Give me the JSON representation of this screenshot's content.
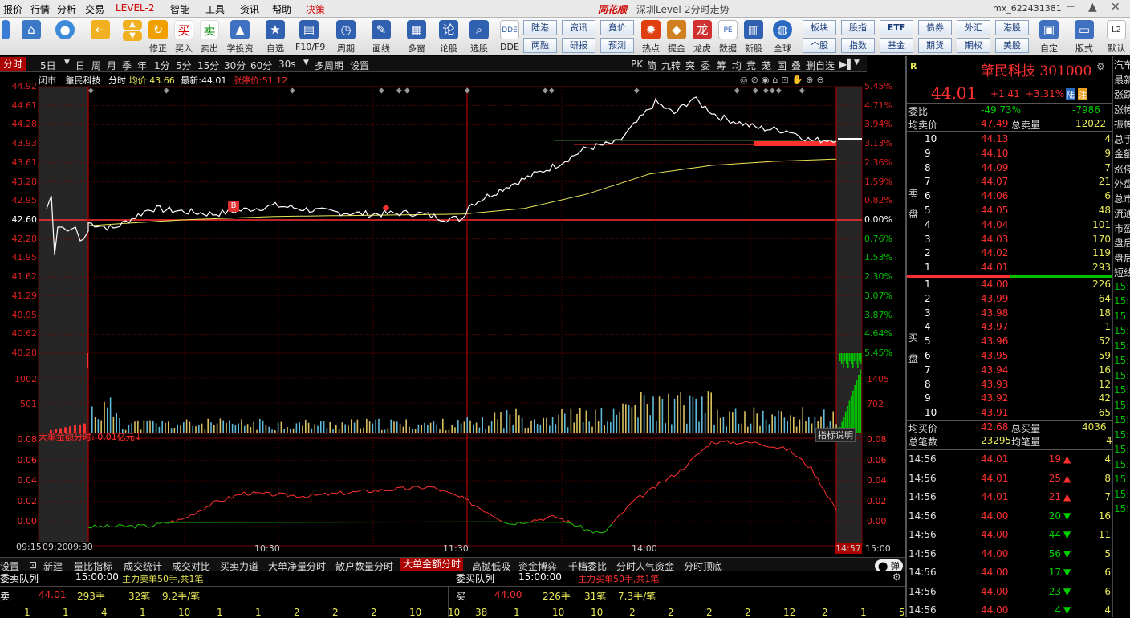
{
  "menubar": {
    "items": [
      "报价",
      "行情",
      "分析",
      "交易",
      "LEVEL-2",
      "智能",
      "工具",
      "资讯",
      "帮助",
      "决策"
    ],
    "title_brand": "同花顺",
    "title": "深圳Level-2分时走势",
    "account": "mx_622431381"
  },
  "toolbar": {
    "buttons": [
      "修正",
      "买入",
      "卖出",
      "学投资",
      "自选",
      "F10/F9",
      "周期",
      "画线",
      "多窗",
      "论股",
      "选股",
      "DDE",
      "热点",
      "提金",
      "龙虎",
      "数据",
      "新股",
      "全球",
      "自定",
      "版式",
      "默认"
    ],
    "small": [
      "陆港",
      "资讯",
      "竟价",
      "两融",
      "研报",
      "预测",
      "板块",
      "股指",
      "ETF",
      "债券",
      "外汇",
      "港股",
      "个股",
      "指数",
      "基金",
      "期货",
      "期权",
      "美股"
    ]
  },
  "period": {
    "items": [
      "分时",
      "5日",
      "日",
      "周",
      "月",
      "季",
      "年",
      "1分",
      "5分",
      "15分",
      "30分",
      "60分",
      "30s",
      "多周期",
      "设置"
    ],
    "right": [
      "PK",
      "简",
      "九转",
      "突",
      "委",
      "筹",
      "均",
      "竞",
      "茏",
      "固",
      "叠",
      "删自选"
    ]
  },
  "chartinfo": {
    "status": "闭市",
    "name": "肇民科技",
    "mode": "分时",
    "avg_label": "均价:",
    "avg": "43.66",
    "last_label": "最新:",
    "last": "44.01",
    "limit_label": "涨停价:",
    "limit": "51.12"
  },
  "colors": {
    "up": "#ff3030",
    "down": "#00c000",
    "price": "#ffffff",
    "avg": "#e8e85a",
    "grid": "#7a0000",
    "vol_yellow": "#d8c060",
    "vol_cyan": "#60b8d8"
  },
  "axes": {
    "left": [
      "44.92",
      "44.61",
      "44.28",
      "43.93",
      "43.61",
      "43.28",
      "42.95",
      "42.60",
      "42.28",
      "41.95",
      "41.62",
      "41.29",
      "40.95",
      "40.62",
      "40.28"
    ],
    "right": [
      "5.45%",
      "4.71%",
      "3.94%",
      "3.13%",
      "2.36%",
      "1.59%",
      "0.82%",
      "0.00%",
      "0.76%",
      "1.53%",
      "2.30%",
      "3.07%",
      "3.87%",
      "4.64%",
      "5.45%"
    ],
    "vol_left": [
      "1002",
      "501"
    ],
    "vol_right": [
      "1405",
      "702"
    ],
    "ind": [
      "0.08",
      "0.06",
      "0.04",
      "0.02",
      "0.00"
    ],
    "time": [
      "09:15",
      "09:20",
      "09:30",
      "10:30",
      "11:30",
      "14:00",
      "14:57",
      "15:00"
    ],
    "b_marker": "B"
  },
  "indicator": {
    "title": "大单金额分时:",
    "value": "0.01亿元↓",
    "explain": "指标说明"
  },
  "chart_data": {
    "type": "line",
    "title": "",
    "x": [
      "09:30",
      "10:00",
      "10:30",
      "11:00",
      "11:30",
      "13:30",
      "14:00",
      "14:30",
      "14:57"
    ],
    "series": [
      {
        "name": "",
        "values": [
          42.6,
          42.85,
          42.82,
          42.68,
          42.65,
          43.4,
          44.62,
          44.3,
          44.01
        ]
      },
      {
        "name": "均价",
        "values": [
          42.55,
          42.62,
          42.68,
          42.7,
          42.71,
          42.85,
          43.5,
          43.62,
          43.66
        ]
      }
    ],
    "ylim": [
      40.28,
      44.92
    ]
  },
  "bottomtabs": [
    "设置",
    "新建",
    "量比指标",
    "成交统计",
    "成交对比",
    "买卖力道",
    "大单净量分时",
    "散户数量分时",
    "大单金额分时",
    "高抛低吸",
    "资金博弈",
    "千档委比",
    "分时人气资金",
    "分时顶底"
  ],
  "bottom_toggle": "弹",
  "queue": {
    "sell_title": "委卖队列",
    "sell_time": "15:00:00",
    "sell_note": "主力卖单50手,共1笔",
    "buy_title": "委买队列",
    "buy_time": "15:00:00",
    "buy_note": "主力买单50手,共1笔",
    "sell_row": [
      "卖一",
      "44.01",
      "293手",
      "32笔",
      "9.2手/笔"
    ],
    "buy_row": [
      "买一",
      "44.00",
      "226手",
      "31笔",
      "7.3手/笔"
    ],
    "sell_nums": [
      "1",
      "1",
      "4",
      "1",
      "10",
      "1",
      "1",
      "2",
      "2",
      "2",
      "10",
      "10"
    ],
    "buy_nums": [
      "38",
      "1",
      "10",
      "10",
      "2",
      "2",
      "2",
      "2",
      "12",
      "2",
      "1",
      "5"
    ]
  },
  "right": {
    "r_label": "R",
    "name": "肇民科技 301000",
    "price": "44.01",
    "change": "+1.41",
    "pct": "+3.31%",
    "tag1": "陆",
    "tag2": "注",
    "weibi_label": "委比",
    "weibi": "-49.73%",
    "weicha": "-7986",
    "avgsell_label": "均卖价",
    "avgsell": "47.49",
    "totalsell_label": "总卖量",
    "totalsell": "12022",
    "sell_side": "卖盘",
    "buy_side": "买盘",
    "asks": [
      [
        "10",
        "44.13",
        "4"
      ],
      [
        "9",
        "44.10",
        "9"
      ],
      [
        "8",
        "44.09",
        "7"
      ],
      [
        "7",
        "44.07",
        "21"
      ],
      [
        "6",
        "44.06",
        "6"
      ],
      [
        "5",
        "44.05",
        "48"
      ],
      [
        "4",
        "44.04",
        "101"
      ],
      [
        "3",
        "44.03",
        "170"
      ],
      [
        "2",
        "44.02",
        "119"
      ],
      [
        "1",
        "44.01",
        "293"
      ]
    ],
    "bids": [
      [
        "1",
        "44.00",
        "226"
      ],
      [
        "2",
        "43.99",
        "64"
      ],
      [
        "3",
        "43.98",
        "18"
      ],
      [
        "4",
        "43.97",
        "1"
      ],
      [
        "5",
        "43.96",
        "52"
      ],
      [
        "6",
        "43.95",
        "59"
      ],
      [
        "7",
        "43.94",
        "16"
      ],
      [
        "8",
        "43.93",
        "12"
      ],
      [
        "9",
        "43.92",
        "42"
      ],
      [
        "10",
        "43.91",
        "65"
      ]
    ],
    "avgbuy_label": "均买价",
    "avgbuy": "42.68",
    "totalbuy_label": "总买量",
    "totalbuy": "4036",
    "totaltrades_label": "总笔数",
    "totaltrades": "23295",
    "avgvol_label": "均笔量",
    "avgvol": "4",
    "ticks": [
      [
        "14:56",
        "44.01",
        "19",
        "4"
      ],
      [
        "14:56",
        "44.01",
        "25",
        "8"
      ],
      [
        "14:56",
        "44.01",
        "21",
        "7"
      ],
      [
        "14:56",
        "44.00",
        "20",
        "16"
      ],
      [
        "14:56",
        "44.00",
        "44",
        "11"
      ],
      [
        "14:56",
        "44.00",
        "56",
        "5"
      ],
      [
        "14:56",
        "44.00",
        "17",
        "6"
      ],
      [
        "14:56",
        "44.00",
        "23",
        "6"
      ],
      [
        "14:56",
        "44.00",
        "4",
        "4"
      ]
    ]
  },
  "far": [
    "汽车",
    "最新",
    "涨跌",
    "涨幅",
    "振幅",
    "总手",
    "金额",
    "涨停",
    "外盘",
    "总市",
    "流通",
    "市盈",
    "盘后",
    "盘后",
    "短线",
    "15:0",
    "15:0",
    "15:0",
    "15:0",
    "15:0",
    "15:0",
    "15:0",
    "15:0",
    "15:0",
    "15:0",
    "15:0",
    "15:0",
    "15:0",
    "15:0",
    "15:0",
    "15:0"
  ]
}
